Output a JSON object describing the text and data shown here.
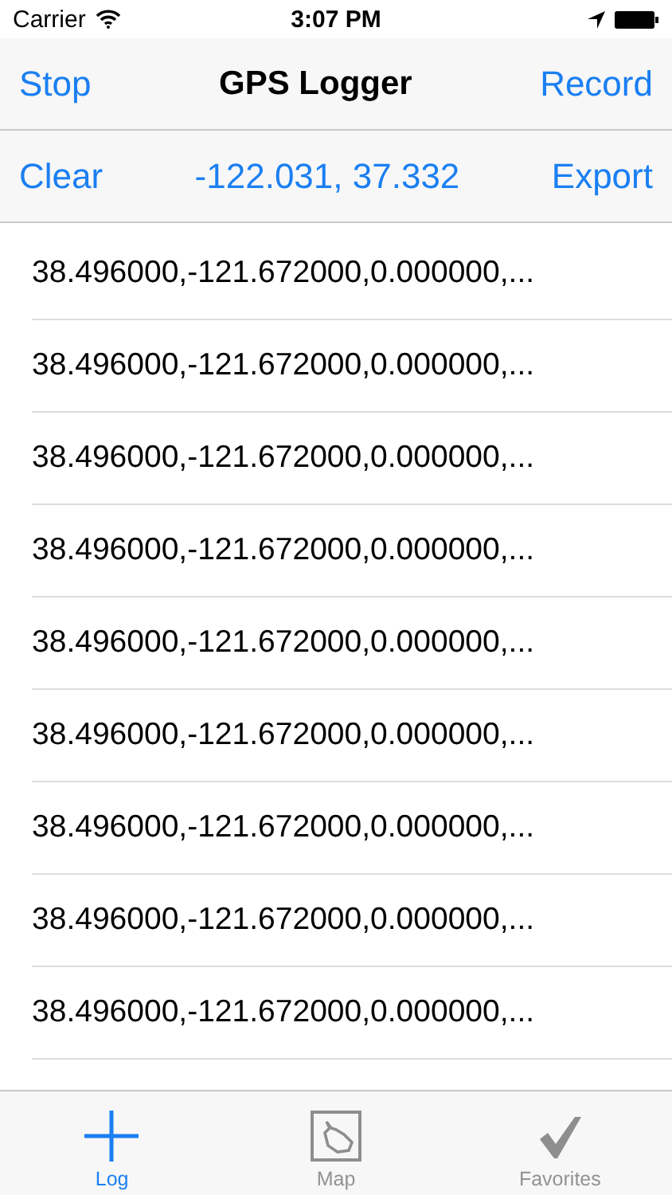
{
  "status_bar": {
    "carrier": "Carrier",
    "time": "3:07 PM"
  },
  "nav_bar": {
    "left": "Stop",
    "title": "GPS Logger",
    "right": "Record"
  },
  "toolbar": {
    "left": "Clear",
    "coordinates": "-122.031, 37.332",
    "right": "Export"
  },
  "rows": [
    "38.496000,-121.672000,0.000000,...",
    "38.496000,-121.672000,0.000000,...",
    "38.496000,-121.672000,0.000000,...",
    "38.496000,-121.672000,0.000000,...",
    "38.496000,-121.672000,0.000000,...",
    "38.496000,-121.672000,0.000000,...",
    "38.496000,-121.672000,0.000000,...",
    "38.496000,-121.672000,0.000000,...",
    "38.496000,-121.672000,0.000000,..."
  ],
  "tabs": [
    {
      "label": "Log",
      "kind": "plus",
      "selected": true
    },
    {
      "label": "Map",
      "kind": "map",
      "selected": false
    },
    {
      "label": "Favorites",
      "kind": "check",
      "selected": false
    }
  ]
}
